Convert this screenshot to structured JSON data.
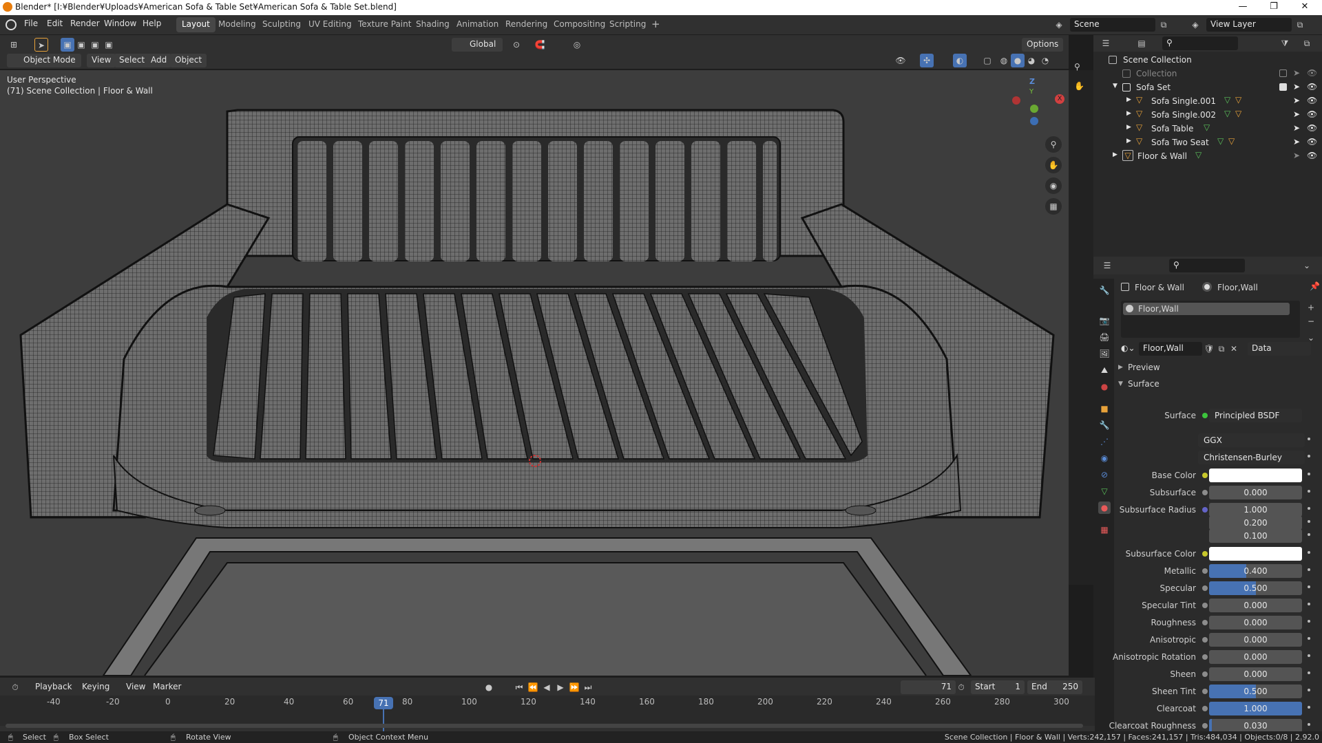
{
  "title_bar": {
    "text": "Blender* [I:¥Blender¥Uploads¥American Sofa & Table Set¥American Sofa & Table Set.blend]",
    "minimize": "—",
    "maximize": "❐",
    "close": "✕"
  },
  "menu": {
    "items": [
      "File",
      "Edit",
      "Render",
      "Window",
      "Help"
    ]
  },
  "workspaces": {
    "tabs": [
      "Layout",
      "Modeling",
      "Sculpting",
      "UV Editing",
      "Texture Paint",
      "Shading",
      "Animation",
      "Rendering",
      "Compositing",
      "Scripting"
    ],
    "active": "Layout",
    "add": "+"
  },
  "scene": {
    "label": "Scene",
    "view_layer": "View Layer"
  },
  "viewport_header": {
    "mode": "Object Mode",
    "menus": [
      "View",
      "Select",
      "Add",
      "Object"
    ],
    "transform_orientation": "Global",
    "options": "Options"
  },
  "viewport": {
    "perspective": "User Perspective",
    "collection_info": "(71) Scene Collection | Floor & Wall",
    "axis_x": "X",
    "axis_y": "Y",
    "axis_z": "Z"
  },
  "outliner": {
    "root": "Scene Collection",
    "rows": [
      {
        "label": "Collection",
        "dim": true
      },
      {
        "label": "Sofa Set"
      },
      {
        "label": "Sofa Single.001"
      },
      {
        "label": "Sofa Single.002"
      },
      {
        "label": "Sofa Table"
      },
      {
        "label": "Sofa Two Seat"
      },
      {
        "label": "Floor & Wall"
      }
    ]
  },
  "properties": {
    "breadcrumb_object": "Floor & Wall",
    "breadcrumb_material": "Floor,Wall",
    "slot": "Floor,Wall",
    "material_name": "Floor,Wall",
    "link": "Data",
    "preview": "Preview",
    "surface_panel": "Surface",
    "surface_label": "Surface",
    "surface_shader": "Principled BSDF",
    "distribution": "GGX",
    "subsurface_method": "Christensen-Burley",
    "fields": [
      {
        "label": "Base Color",
        "value": "",
        "color": "#ffffff",
        "dot": "#c8c82c"
      },
      {
        "label": "Subsurface",
        "value": "0.000",
        "fill": 0,
        "dot": "#8c8c8c"
      },
      {
        "label": "Subsurface Radius",
        "value": "1.000",
        "fill": 0,
        "dot": "#6464c8"
      },
      {
        "label": "",
        "value": "0.200",
        "fill": 0,
        "dot": ""
      },
      {
        "label": "",
        "value": "0.100",
        "fill": 0,
        "dot": ""
      },
      {
        "label": "Subsurface Color",
        "value": "",
        "color": "#ffffff",
        "dot": "#c8c82c"
      },
      {
        "label": "Metallic",
        "value": "0.400",
        "fill": 0.4,
        "dot": "#8c8c8c"
      },
      {
        "label": "Specular",
        "value": "0.500",
        "fill": 0.5,
        "dot": "#8c8c8c"
      },
      {
        "label": "Specular Tint",
        "value": "0.000",
        "fill": 0,
        "dot": "#8c8c8c"
      },
      {
        "label": "Roughness",
        "value": "0.000",
        "fill": 0,
        "dot": "#8c8c8c"
      },
      {
        "label": "Anisotropic",
        "value": "0.000",
        "fill": 0,
        "dot": "#8c8c8c"
      },
      {
        "label": "Anisotropic Rotation",
        "value": "0.000",
        "fill": 0,
        "dot": "#8c8c8c"
      },
      {
        "label": "Sheen",
        "value": "0.000",
        "fill": 0,
        "dot": "#8c8c8c"
      },
      {
        "label": "Sheen Tint",
        "value": "0.500",
        "fill": 0.5,
        "dot": "#8c8c8c"
      },
      {
        "label": "Clearcoat",
        "value": "1.000",
        "fill": 1,
        "dot": "#8c8c8c"
      },
      {
        "label": "Clearcoat Roughness",
        "value": "0.030",
        "fill": 0.03,
        "dot": "#8c8c8c"
      }
    ]
  },
  "timeline": {
    "menus": [
      "Playback",
      "Keying",
      "View",
      "Marker"
    ],
    "current_frame": "71",
    "start_label": "Start",
    "start": "1",
    "end_label": "End",
    "end": "250",
    "ticks": [
      "-40",
      "-20",
      "0",
      "20",
      "40",
      "60",
      "80",
      "100",
      "120",
      "140",
      "160",
      "180",
      "200",
      "220",
      "240",
      "260",
      "280",
      "300"
    ],
    "frame_badge": "71"
  },
  "statusbar": {
    "select": "Select",
    "box_select": "Box Select",
    "rotate": "Rotate View",
    "context": "Object Context Menu",
    "stats": "Scene Collection | Floor & Wall | Verts:242,157 | Faces:241,157 | Tris:484,034 | Objects:0/8 | 2.92.0"
  }
}
